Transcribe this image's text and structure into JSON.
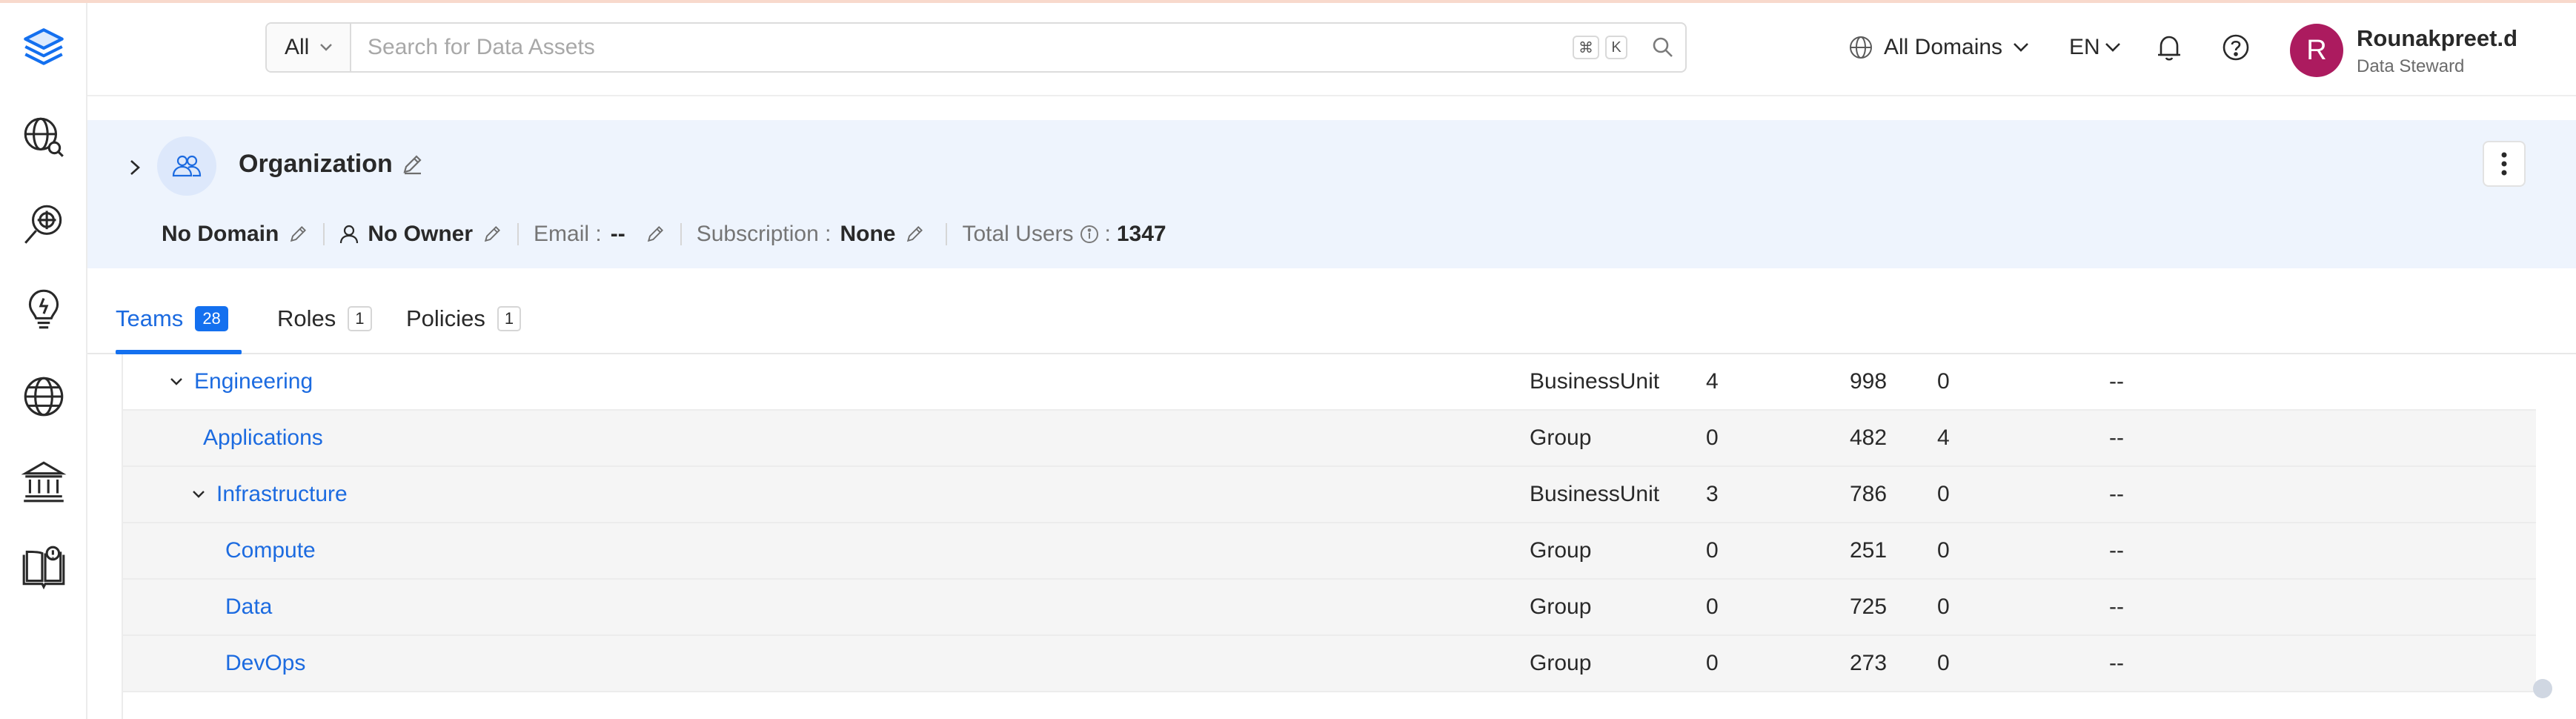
{
  "header": {
    "search_filter": "All",
    "search_placeholder": "Search for Data Assets",
    "kbd_cmd": "⌘",
    "kbd_k": "K",
    "domains_label": "All Domains",
    "language": "EN",
    "user": {
      "initial": "R",
      "name": "Rounakpreet.d",
      "role": "Data Steward",
      "avatar_color": "#ac1b5f"
    }
  },
  "organization": {
    "title": "Organization",
    "domain": "No Domain",
    "owner": "No Owner",
    "email_label": "Email :",
    "email_value": "--",
    "subscription_label": "Subscription :",
    "subscription_value": "None",
    "total_users_label": "Total Users",
    "total_users_sep": ":",
    "total_users_value": "1347"
  },
  "tabs": [
    {
      "label": "Teams",
      "count": "28",
      "active": true
    },
    {
      "label": "Roles",
      "count": "1",
      "active": false
    },
    {
      "label": "Policies",
      "count": "1",
      "active": false
    }
  ],
  "table": {
    "rows": [
      {
        "name": "Engineering",
        "type": "BusinessUnit",
        "sub_teams": "4",
        "users": "998",
        "assets": "0",
        "description": "--",
        "expandable": true
      },
      {
        "name": "Applications",
        "type": "Group",
        "sub_teams": "0",
        "users": "482",
        "assets": "4",
        "description": "--",
        "expandable": false
      },
      {
        "name": "Infrastructure",
        "type": "BusinessUnit",
        "sub_teams": "3",
        "users": "786",
        "assets": "0",
        "description": "--",
        "expandable": true
      },
      {
        "name": "Compute",
        "type": "Group",
        "sub_teams": "0",
        "users": "251",
        "assets": "0",
        "description": "--",
        "expandable": false
      },
      {
        "name": "Data",
        "type": "Group",
        "sub_teams": "0",
        "users": "725",
        "assets": "0",
        "description": "--",
        "expandable": false
      },
      {
        "name": "DevOps",
        "type": "Group",
        "sub_teams": "0",
        "users": "273",
        "assets": "0",
        "description": "--",
        "expandable": false
      }
    ]
  },
  "colors": {
    "accent": "#1470ef",
    "link": "#1c6be0",
    "org_panel_bg": "#eef4fd",
    "avatar": "#ac1b5f"
  }
}
